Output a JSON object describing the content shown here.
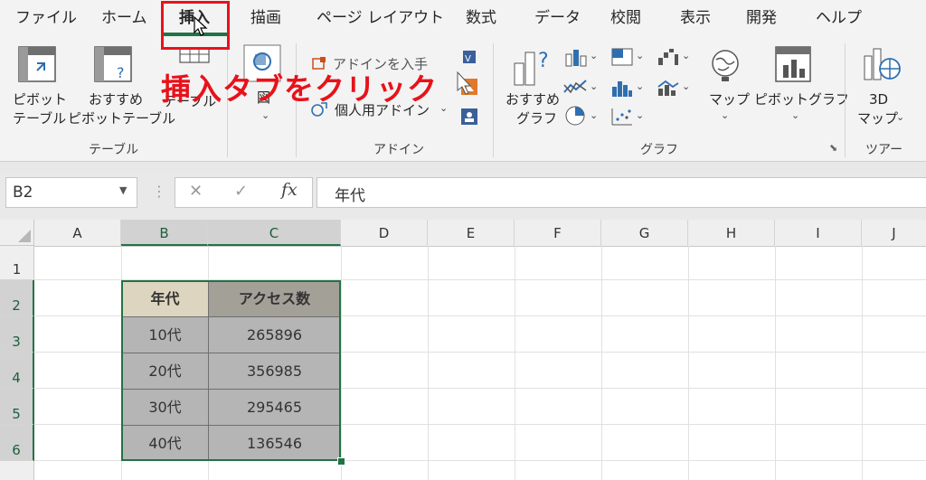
{
  "menu": {
    "tabs": [
      {
        "label": "ファイル"
      },
      {
        "label": "ホーム"
      },
      {
        "label": "挿入"
      },
      {
        "label": "描画"
      },
      {
        "label": "ページ レイアウト"
      },
      {
        "label": "数式"
      },
      {
        "label": "データ"
      },
      {
        "label": "校閲"
      },
      {
        "label": "表示"
      },
      {
        "label": "開発"
      },
      {
        "label": "ヘルプ"
      }
    ],
    "active_tab": "挿入"
  },
  "annotation": "挿入タブをクリック",
  "ribbon": {
    "groups": {
      "table": {
        "label": "テーブル",
        "pivot_table": {
          "line1": "ピボット",
          "line2": "テーブル"
        },
        "recommended_pivot": {
          "line1": "おすすめ",
          "line2": "ピボットテーブル"
        },
        "table_button": "テーブル"
      },
      "illustrations": {
        "figure_label": "図"
      },
      "addins": {
        "label": "アドイン",
        "get_addins": "アドインを入手",
        "my_addins": "個人用アドイン"
      },
      "charts": {
        "label": "グラフ",
        "recommended": {
          "line1": "おすすめ",
          "line2": "グラフ"
        },
        "map": "マップ",
        "pivot_chart": "ピボットグラフ"
      },
      "tours": {
        "label": "ツアー",
        "map3d": {
          "line1": "3D",
          "line2": "マップ"
        }
      }
    }
  },
  "formula_bar": {
    "name_box": "B2",
    "cancel": "✕",
    "enter": "✓",
    "fx": "fx",
    "value": "年代"
  },
  "grid": {
    "columns": [
      "A",
      "B",
      "C",
      "D",
      "E",
      "F",
      "G",
      "H",
      "I",
      "J"
    ],
    "rows": [
      "1",
      "2",
      "3",
      "4",
      "5",
      "6"
    ],
    "table": {
      "headers": [
        "年代",
        "アクセス数"
      ],
      "rows": [
        [
          "10代",
          "265896"
        ],
        [
          "20代",
          "356985"
        ],
        [
          "30代",
          "295465"
        ],
        [
          "40代",
          "136546"
        ]
      ]
    }
  },
  "colors": {
    "accent": "#217346",
    "annotation": "#e8121a",
    "header_cell_year": "#ddd5bf",
    "header_cell_access": "#a3a098",
    "data_cell": "#b5b5b5"
  }
}
